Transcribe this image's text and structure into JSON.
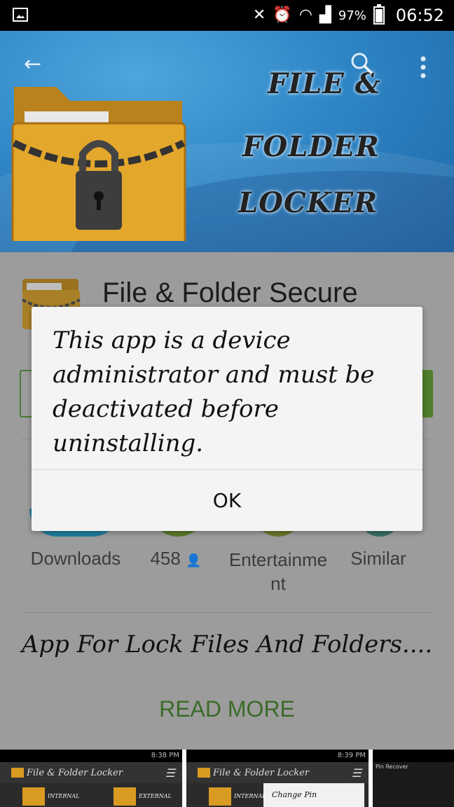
{
  "status_bar": {
    "battery_percent": "97%",
    "time": "06:52"
  },
  "banner": {
    "title_lines": [
      "FILE &",
      "FOLDER",
      "LOCKER"
    ]
  },
  "app": {
    "name": "File & Folder Secure"
  },
  "stats": [
    {
      "label": "Downloads"
    },
    {
      "label": "458",
      "suffix_icon": "person-icon"
    },
    {
      "label": "Entertainme",
      "label2": "nt"
    },
    {
      "label": "Similar"
    }
  ],
  "description": "App For Lock Files And Folders....",
  "read_more": "READ MORE",
  "screenshots": [
    {
      "time": "8:38 PM",
      "title": "File & Folder Locker",
      "left_label": "INTERNAL",
      "right_label": "EXTERNAL"
    },
    {
      "time": "8:39 PM",
      "title": "File & Folder Locker",
      "left_label": "INTERNAL",
      "right_label": "Change Pin"
    },
    {
      "title": "Pin Recover"
    }
  ],
  "dialog": {
    "message": "This app is a device administrator and must be deactivated before uninstalling.",
    "ok_label": "OK"
  },
  "colors": {
    "banner_blue": "#2f86c6",
    "install_green": "#4f7f2c",
    "read_more_green": "#3a6b28"
  }
}
